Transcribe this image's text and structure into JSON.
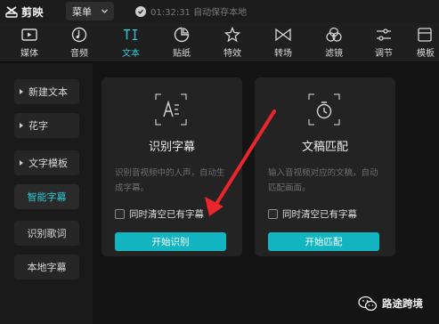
{
  "titlebar": {
    "app_name": "剪映",
    "menu_label": "菜单",
    "save_status": "01:32:31 自动保存本地"
  },
  "toolbar": {
    "tools": [
      {
        "label": "媒体",
        "icon": "media-icon",
        "active": false
      },
      {
        "label": "音频",
        "icon": "audio-icon",
        "active": false
      },
      {
        "label": "文本",
        "icon": "text-icon",
        "active": true
      },
      {
        "label": "贴纸",
        "icon": "sticker-icon",
        "active": false
      },
      {
        "label": "特效",
        "icon": "effects-icon",
        "active": false
      },
      {
        "label": "转场",
        "icon": "transition-icon",
        "active": false
      },
      {
        "label": "滤镜",
        "icon": "filter-icon",
        "active": false
      },
      {
        "label": "调节",
        "icon": "adjust-icon",
        "active": false
      },
      {
        "label": "模板",
        "icon": "template-icon",
        "active": false
      }
    ]
  },
  "sidebar": {
    "items": [
      {
        "label": "新建文本",
        "expandable": true
      },
      {
        "label": "花字",
        "expandable": true
      },
      {
        "label": "文字模板",
        "expandable": true
      },
      {
        "label": "智能字幕",
        "expandable": false,
        "active": true
      },
      {
        "label": "识别歌词",
        "expandable": false
      },
      {
        "label": "本地字幕",
        "expandable": false
      }
    ]
  },
  "cards": [
    {
      "title": "识别字幕",
      "description": "识别音视频中的人声，自动生成字幕。",
      "checkbox_label": "同时清空已有字幕",
      "button_label": "开始识别"
    },
    {
      "title": "文稿匹配",
      "description": "输入音视频对应的文稿，自动匹配画面。",
      "checkbox_label": "同时清空已有字幕",
      "button_label": "开始匹配"
    }
  ],
  "watermark": {
    "text": "路途跨境"
  },
  "colors": {
    "accent": "#2cc9d6",
    "button": "#13b5c1",
    "annotation_arrow": "#e8262b"
  }
}
